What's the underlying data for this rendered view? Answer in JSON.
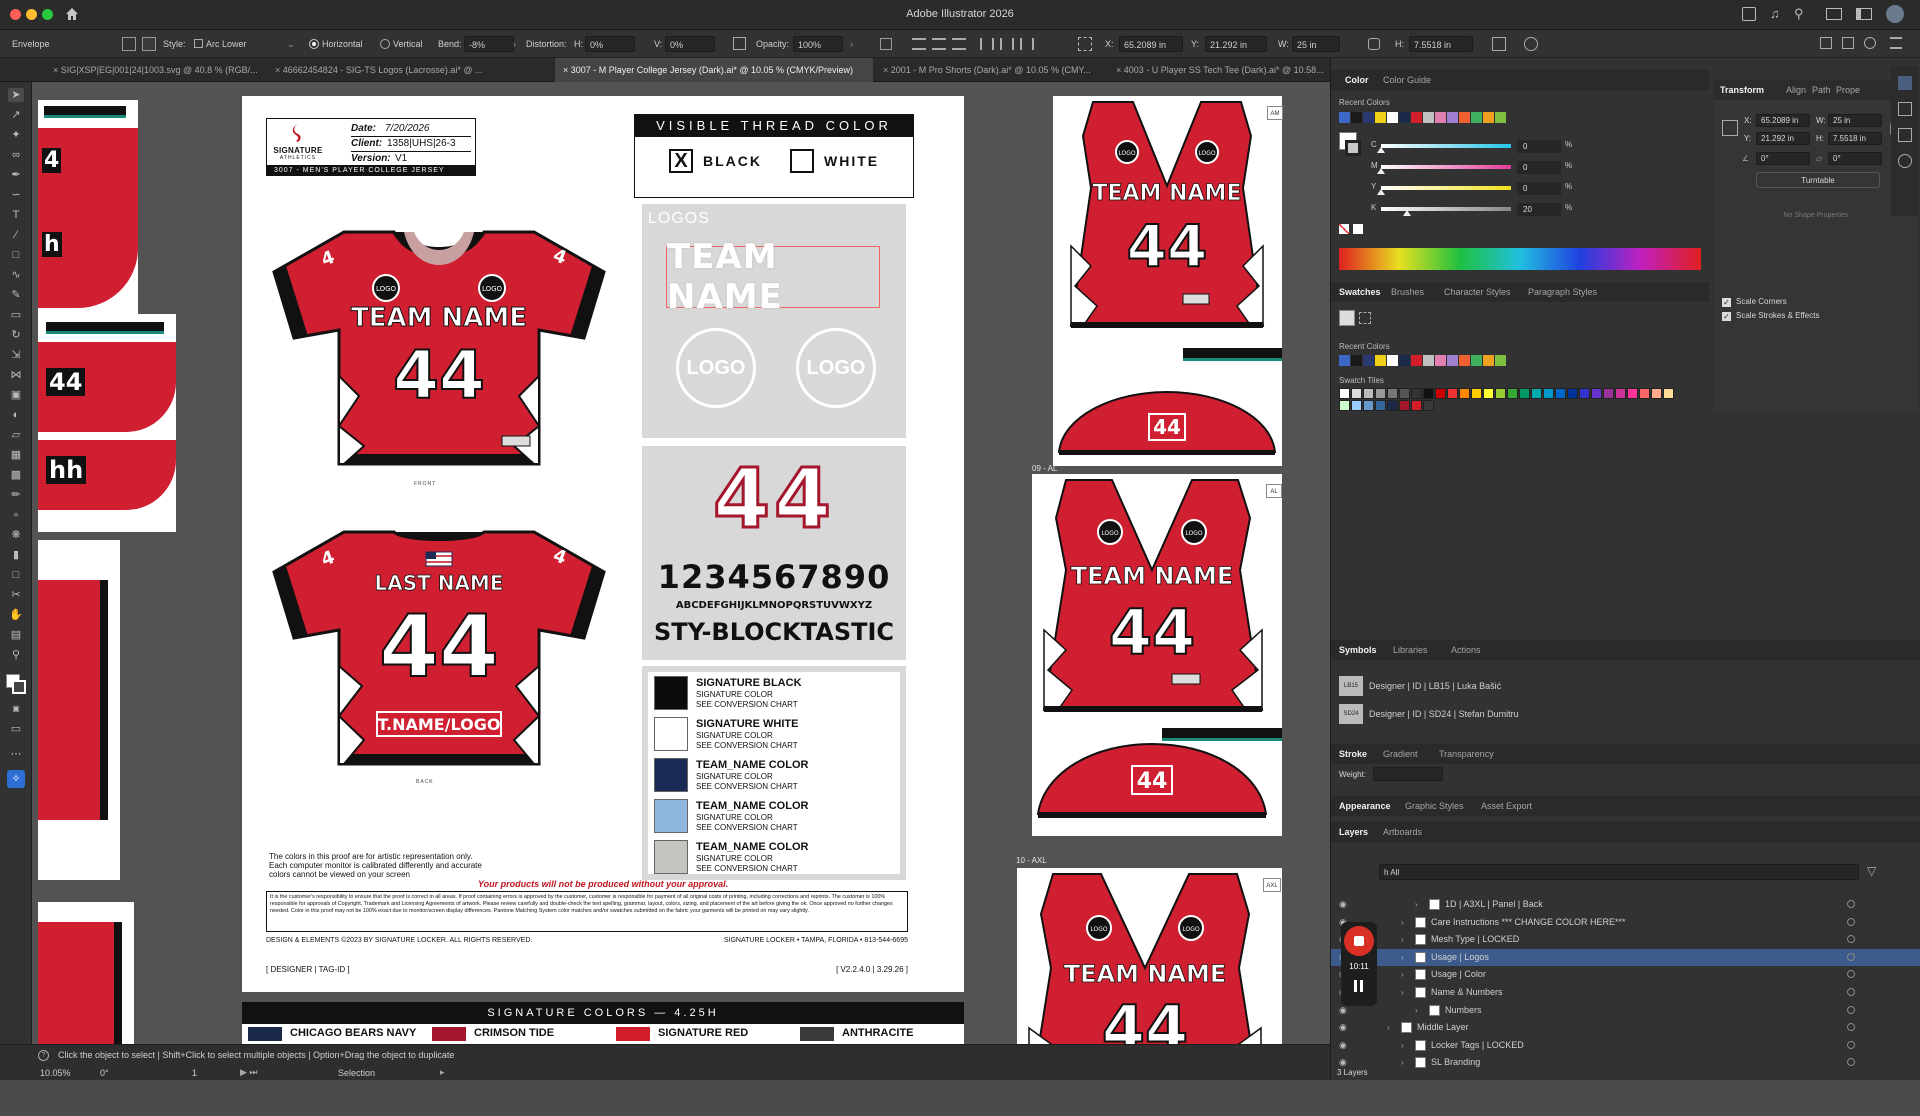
{
  "titlebar": {
    "title": "Adobe Illustrator 2026"
  },
  "control_bar": {
    "mode_label": "Envelope",
    "style_label": "Style:",
    "style_value": "Arc Lower",
    "horizontal_label": "Horizontal",
    "vertical_label": "Vertical",
    "bend_label": "Bend:",
    "bend_value": "-8%",
    "distortion_label": "Distortion:",
    "h_label": "H:",
    "h_value": "0%",
    "v_label": "V:",
    "v_value": "0%",
    "opacity_label": "Opacity:",
    "opacity_value": "100%",
    "x_label": "X:",
    "x_value": "65.2089 in",
    "y_label": "Y:",
    "y_value": "21.292 in",
    "w_label": "W:",
    "w_value": "25 in",
    "height_label": "H:",
    "height_value": "7.5518 in"
  },
  "doc_tabs": [
    "SIG|XSP|EG|001|24|1003.svg @ 40.8 % (RGB/...",
    "46662454824 - SIG-TS Logos (Lacrosse).ai* @ ...",
    "3007 - M Player College Jersey (Dark).ai* @ 10.05 % (CMYK/Preview)",
    "2001 - M Pro Shorts (Dark).ai* @ 10.05 % (CMY...",
    "4003 - U Player SS Tech Tee (Dark).ai* @ 10.58..."
  ],
  "artboard": {
    "brand_line1": "SIGNATURE",
    "brand_line2": "ATHLETICS",
    "date_label": "Date:",
    "date_value": "7/20/2026",
    "client_label": "Client:",
    "client_value": "1358|UHS|26-3",
    "version_label": "Version:",
    "version_value": "V1",
    "product_line": "3007 - MEN'S PLAYER COLLEGE JERSEY",
    "thread_title": "VISIBLE THREAD COLOR",
    "thread_black": "BLACK",
    "thread_black_mark": "X",
    "thread_white": "WHITE",
    "logos_title": "LOGOS",
    "logos_team_name": "TEAM NAME",
    "logo_text": "LOGO",
    "number_sample": "44",
    "digits": "1234567890",
    "alphabet": "ABCDEFGHIJKLMNOPQRSTUVWXYZ",
    "font_name": "STY-BLOCKTASTIC",
    "front_label": "FRONT",
    "back_label": "BACK",
    "front_team_name": "TEAM NAME",
    "front_number": "44",
    "back_last_name": "LAST NAME",
    "back_number": "44",
    "back_tname": "T.NAME/LOGO",
    "sleeve_number": "4",
    "color_chips": [
      {
        "name": "SIGNATURE BLACK",
        "l1": "SIGNATURE COLOR",
        "l2": "SEE CONVERSION CHART",
        "hex": "#0c0c0c"
      },
      {
        "name": "SIGNATURE WHITE",
        "l1": "SIGNATURE COLOR",
        "l2": "SEE CONVERSION CHART",
        "hex": "#ffffff"
      },
      {
        "name": "TEAM_NAME COLOR",
        "l1": "SIGNATURE COLOR",
        "l2": "SEE CONVERSION CHART",
        "hex": "#1b2a55"
      },
      {
        "name": "TEAM_NAME COLOR",
        "l1": "SIGNATURE COLOR",
        "l2": "SEE CONVERSION CHART",
        "hex": "#8fb6df"
      },
      {
        "name": "TEAM_NAME COLOR",
        "l1": "SIGNATURE COLOR",
        "l2": "SEE CONVERSION CHART",
        "hex": "#c4c4c0"
      }
    ],
    "disclaimer1": "The colors in this proof are for artistic representation only.",
    "disclaimer2": "Each computer monitor is calibrated differently and accurate",
    "disclaimer3": "colors cannot be viewed on your screen",
    "approval_notice": "Your products will not be produced without your approval.",
    "legal_text": "It is the customer's responsibility to ensure that the proof is correct in all areas. If proof containing errors is approved by the customer, customer is responsible for payment of all original costs of printing, including corrections and reprints. The customer is 100% responsible for approvals of Copyright, Trademark and Licensing Agreements of artwork. Please review carefully and double-check the text spelling, grammar, layout, colors, sizing, and placement of the art before giving the ok. Once approved no further changes needed. Color in this proof may not be 100% exact due to monitor/screen display differences. Pantone Matching System color matches and/or swatches submitted on the fabric your garments will be printed on may vary slightly.",
    "copyright": "DESIGN & ELEMENTS ©2023 BY SIGNATURE LOCKER. ALL RIGHTS RESERVED.",
    "address": "SIGNATURE LOCKER • TAMPA, FLORIDA • 813-544-6695",
    "designer_tag": "[ DESIGNER | TAG-ID ]",
    "version_tag": "[ V2.2.4.0 | 3.29.26 ]"
  },
  "signature_colors_bar": {
    "title": "SIGNATURE COLORS — 4.25H",
    "items": [
      {
        "name": "CHICAGO BEARS NAVY",
        "hex": "#1c2a4a"
      },
      {
        "name": "CRIMSON TIDE",
        "hex": "#a3162c"
      },
      {
        "name": "SIGNATURE RED",
        "hex": "#d21d2a"
      },
      {
        "name": "ANTHRACITE",
        "hex": "#3a3a3a"
      }
    ]
  },
  "right_art": {
    "sizes": [
      "09 - AL",
      "10 - AXL"
    ],
    "badges": [
      "AM",
      "AL",
      "AXL"
    ],
    "team_name": "TEAM NAME",
    "number": "44",
    "logo": "LOGO"
  },
  "left_art": {
    "numbers": [
      "4",
      "h",
      "44",
      "hh"
    ]
  },
  "statusbar": {
    "hint": "Click the object to select  |  Shift+Click to select multiple objects  |  Option+Drag the object to duplicate",
    "zoom": "10.05%",
    "rotation": "0°",
    "artboard_num": "1",
    "tool_name": "Selection"
  },
  "color_panel": {
    "tabs": [
      "Color",
      "Color Guide"
    ],
    "recent_label": "Recent Colors",
    "sliders": [
      {
        "label": "C",
        "value": "0",
        "pct": 0,
        "color": "#27c4e8"
      },
      {
        "label": "M",
        "value": "0",
        "pct": 0,
        "color": "#e53c9a"
      },
      {
        "label": "Y",
        "value": "0",
        "pct": 0,
        "color": "#f2e21b"
      },
      {
        "label": "K",
        "value": "20",
        "pct": 20,
        "color": "#888888"
      }
    ],
    "unit": "%"
  },
  "transform_panel": {
    "tabs": [
      "Transform",
      "Align",
      "Path",
      "Prope"
    ],
    "x_label": "X:",
    "x_value": "65.2089 in",
    "y_label": "Y:",
    "y_value": "21.292 in",
    "w_label": "W:",
    "w_value": "25 in",
    "h_label": "H:",
    "h_value": "7.5518 in",
    "angle_value": "0°",
    "shear_value": "0°",
    "button": "Turntable",
    "no_shape": "No Shape Properties",
    "scale_corners": "Scale Corners",
    "scale_strokes": "Scale Strokes & Effects"
  },
  "swatches_panel": {
    "tabs": [
      "Swatches",
      "Brushes",
      "Character Styles",
      "Paragraph Styles"
    ],
    "recent_label": "Recent Colors",
    "tiles_label": "Swatch Tiles"
  },
  "symbols_panel": {
    "tabs": [
      "Symbols",
      "Libraries",
      "Actions"
    ],
    "items": [
      {
        "thumb": "LB15",
        "name": "Designer | ID | LB15 | Luka Bašić"
      },
      {
        "thumb": "SD24",
        "name": "Designer | ID | SD24 | Stefan Dumitru"
      }
    ]
  },
  "stroke_panel": {
    "tabs": [
      "Stroke",
      "Gradient",
      "Transparency"
    ],
    "weight_label": "Weight:"
  },
  "appearance_panel": {
    "tabs": [
      "Appearance",
      "Graphic Styles",
      "Asset Export"
    ]
  },
  "layers_panel": {
    "tabs": [
      "Layers",
      "Artboards"
    ],
    "search_value": "h All",
    "timer": "10:11",
    "rows": [
      {
        "name": "1D | A3XL | Panel | Back",
        "indent": 3,
        "selected": false
      },
      {
        "name": "Care Instructions *** CHANGE COLOR HERE***",
        "indent": 2,
        "selected": false
      },
      {
        "name": "Mesh Type | LOCKED",
        "indent": 2,
        "selected": false
      },
      {
        "name": "Usage | Logos",
        "indent": 2,
        "selected": true
      },
      {
        "name": "Usage | Color",
        "indent": 2,
        "selected": false
      },
      {
        "name": "Name & Numbers",
        "indent": 2,
        "selected": false
      },
      {
        "name": "Numbers",
        "indent": 3,
        "selected": false
      },
      {
        "name": "Middle Layer",
        "indent": 1,
        "selected": false
      },
      {
        "name": "Locker Tags | LOCKED",
        "indent": 2,
        "selected": false
      },
      {
        "name": "SL Branding",
        "indent": 2,
        "selected": false
      }
    ],
    "count": "3 Layers"
  },
  "colors": {
    "jersey_red": "#cf1f30",
    "jersey_dark": "#151515",
    "accent_teal": "#1a8a7a",
    "selection_blue": "#3d5b8a"
  }
}
